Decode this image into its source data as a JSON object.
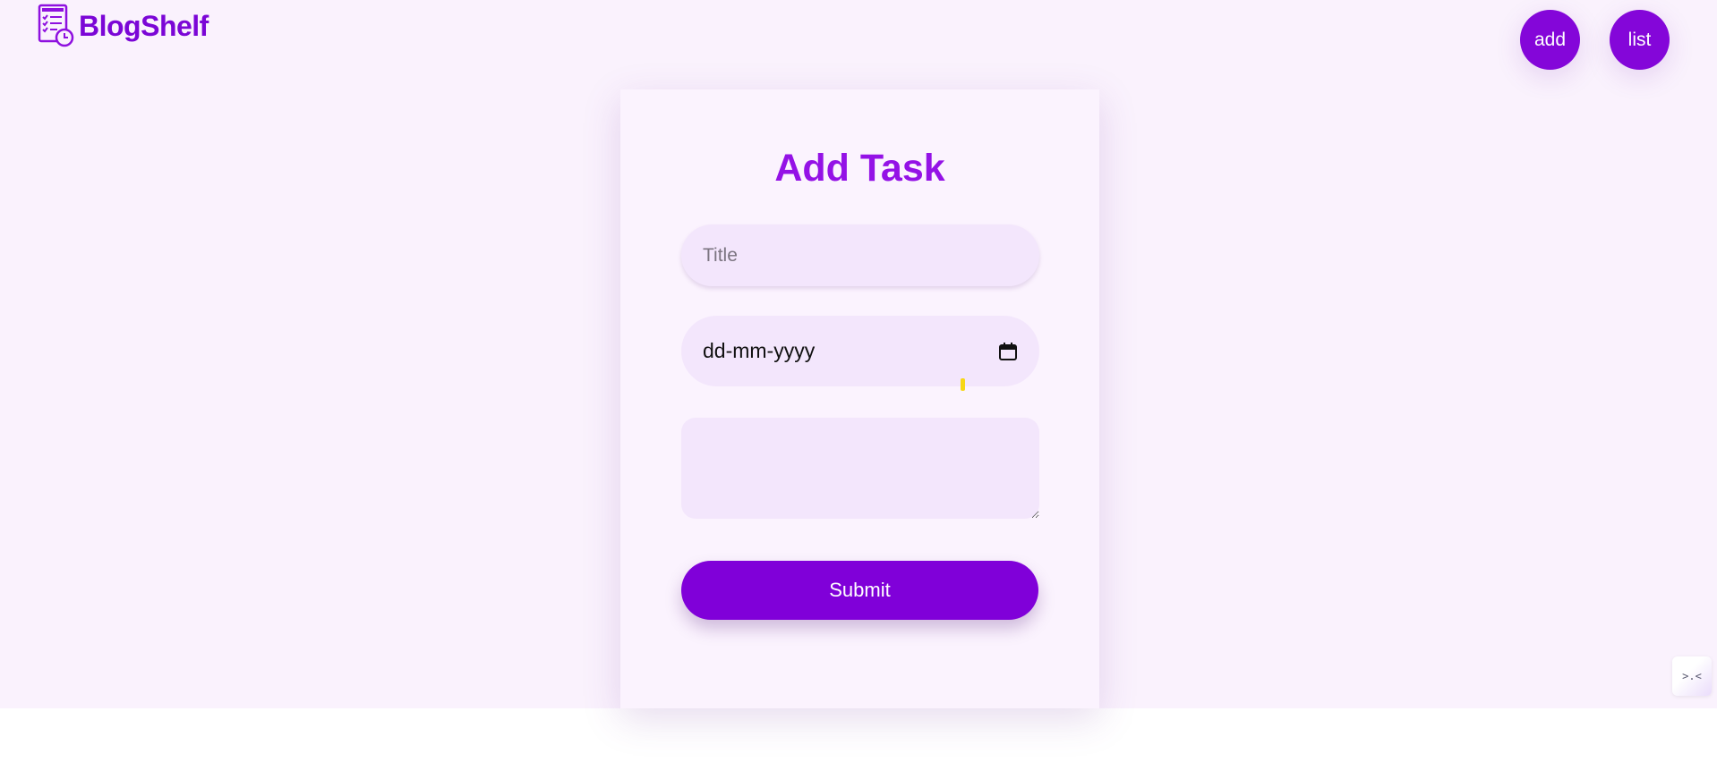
{
  "header": {
    "brand_name": "BlogShelf",
    "nav": {
      "add_label": "add",
      "list_label": "list"
    }
  },
  "form": {
    "heading": "Add Task",
    "title_field": {
      "placeholder": "Title",
      "value": ""
    },
    "date_field": {
      "display_text": "dd-mm-yyyy"
    },
    "description_field": {
      "value": ""
    },
    "submit_label": "Submit"
  },
  "corner_widget": {
    "glyph": ">.<"
  },
  "colors": {
    "brand": "#8406d9",
    "heading": "#9412e6",
    "page_background": "#faf2fd",
    "card_background": "#fbf3fe",
    "input_background": "#f3e6fc"
  },
  "icons": {
    "logo": "checklist-clock-icon",
    "date_picker": "calendar-icon"
  }
}
